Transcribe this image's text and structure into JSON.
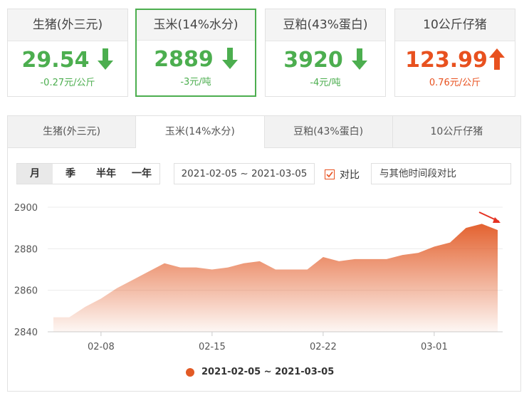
{
  "cards": [
    {
      "title": "生猪(外三元)",
      "value": "29.54",
      "change": "-0.27元/公斤",
      "direction": "down",
      "color": "#4cae4f"
    },
    {
      "title": "玉米(14%水分)",
      "value": "2889",
      "change": "-3元/吨",
      "direction": "down",
      "color": "#4cae4f"
    },
    {
      "title": "豆粕(43%蛋白)",
      "value": "3920",
      "change": "-4元/吨",
      "direction": "down",
      "color": "#4cae4f"
    },
    {
      "title": "10公斤仔猪",
      "value": "123.99",
      "change": "0.76元/公斤",
      "direction": "up",
      "color": "#e8511f"
    }
  ],
  "tabs": [
    "生猪(外三元)",
    "玉米(14%水分)",
    "豆粕(43%蛋白)",
    "10公斤仔猪"
  ],
  "active_tab": 1,
  "period": [
    "月",
    "季",
    "半年",
    "一年"
  ],
  "active_period": 0,
  "date_range": "2021-02-05 ~ 2021-03-05",
  "compare": {
    "label": "对比",
    "checked": true,
    "placeholder": "与其他时间段对比"
  },
  "legend": "2021-02-05 ~ 2021-03-05",
  "colors": {
    "accent": "#e25a25",
    "green": "#4cae4f",
    "red": "#e8511f"
  },
  "chart_data": {
    "type": "area",
    "x": [
      "2021-02-05",
      "2021-02-06",
      "2021-02-07",
      "2021-02-08",
      "2021-02-09",
      "2021-02-10",
      "2021-02-11",
      "2021-02-12",
      "2021-02-13",
      "2021-02-14",
      "2021-02-15",
      "2021-02-16",
      "2021-02-17",
      "2021-02-18",
      "2021-02-19",
      "2021-02-20",
      "2021-02-21",
      "2021-02-22",
      "2021-02-23",
      "2021-02-24",
      "2021-02-25",
      "2021-02-26",
      "2021-02-27",
      "2021-02-28",
      "2021-03-01",
      "2021-03-02",
      "2021-03-03",
      "2021-03-04",
      "2021-03-05"
    ],
    "xticks": [
      {
        "label": "02-08",
        "index": 3
      },
      {
        "label": "02-15",
        "index": 10
      },
      {
        "label": "02-22",
        "index": 17
      },
      {
        "label": "03-01",
        "index": 24
      }
    ],
    "series": [
      {
        "name": "2021-02-05 ~ 2021-03-05",
        "values": [
          2847,
          2847,
          2852,
          2856,
          2861,
          2865,
          2869,
          2873,
          2871,
          2871,
          2870,
          2871,
          2873,
          2874,
          2870,
          2870,
          2870,
          2876,
          2874,
          2875,
          2875,
          2875,
          2877,
          2878,
          2881,
          2883,
          2890,
          2892,
          2889
        ]
      }
    ],
    "ylim": [
      2840,
      2900
    ],
    "yticks": [
      2840,
      2860,
      2880,
      2900
    ],
    "grid": true
  }
}
